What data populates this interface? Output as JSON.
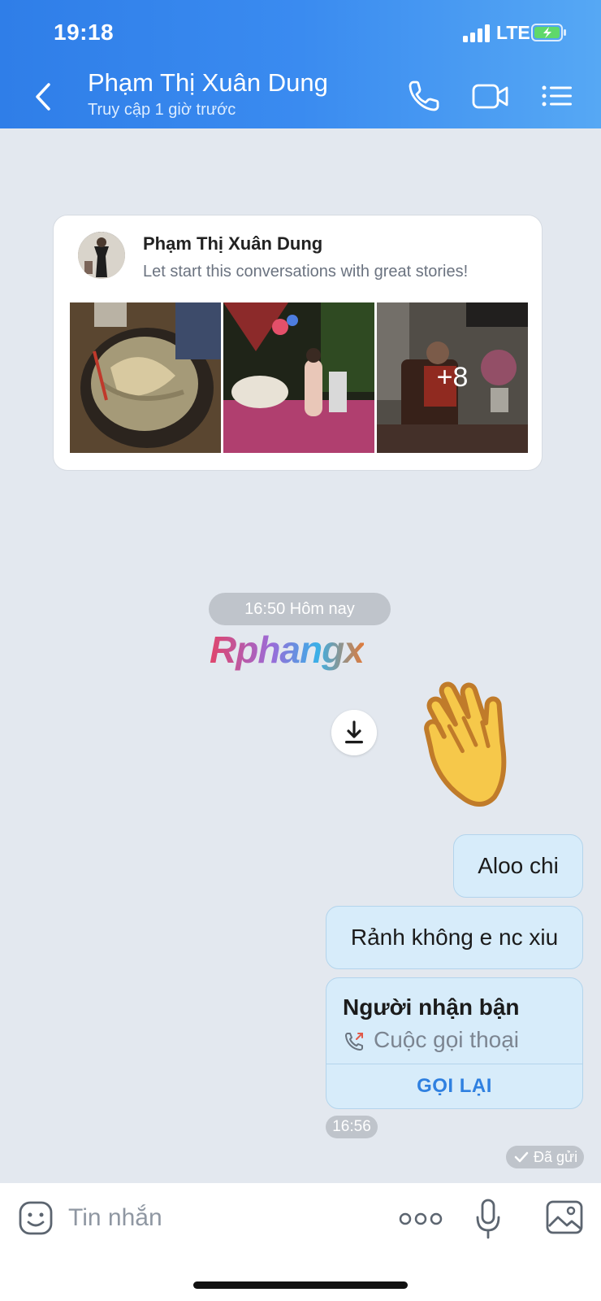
{
  "status_bar": {
    "time": "19:18",
    "network": "LTE"
  },
  "header": {
    "contact_name": "Phạm Thị Xuân Dung",
    "last_seen": "Truy cập 1 giờ trước",
    "icons": [
      "back-icon",
      "phone-icon",
      "video-call-icon",
      "menu-icon"
    ]
  },
  "story_card": {
    "name": "Phạm Thị Xuân Dung",
    "subtitle": "Let start this conversations with great stories!",
    "more_count": "+8"
  },
  "chat": {
    "date_divider": "16:50 Hôm nay",
    "watermark": "Rphangx",
    "messages": [
      {
        "text": "Aloo chi"
      },
      {
        "text": "Rảnh không e nc xiu"
      }
    ],
    "call": {
      "title": "Người nhận bận",
      "type": "Cuộc gọi thoại",
      "action": "GỌI LẠI"
    },
    "time": "16:56",
    "status": "Đã gửi"
  },
  "composer": {
    "placeholder": "Tin nhắn"
  },
  "colors": {
    "header_start": "#2f7ee8",
    "bubble": "#d7ecfa",
    "accent": "#2f80e0",
    "background": "#e3e8ef"
  }
}
